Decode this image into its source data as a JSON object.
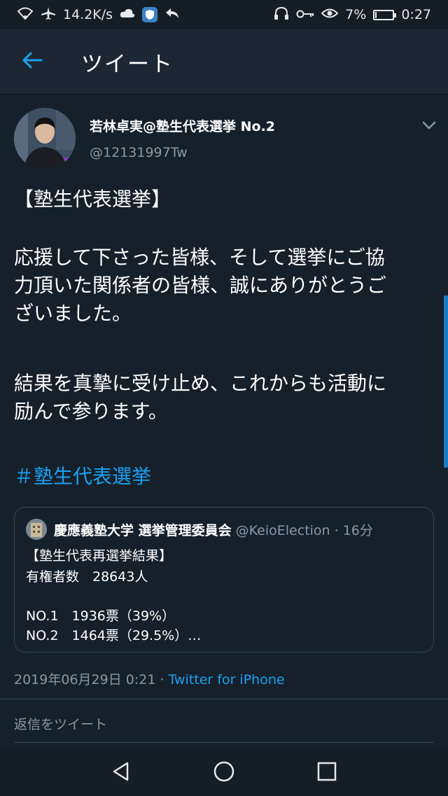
{
  "status_bar": {
    "speed": "14.2K/s",
    "battery": "7%",
    "time": "0:27"
  },
  "header": {
    "title": "ツイート"
  },
  "tweet": {
    "author_name": "若林卓実@塾生代表選挙 No.2",
    "author_handle": "@12131997Tw",
    "text_title": "【塾生代表選挙】",
    "text_p2_l1": "応援して下さった皆様、そして選挙にご協",
    "text_p2_l2": "力頂いた関係者の皆様、誠にありがとうご",
    "text_p2_l3": "ざいました。",
    "text_p3_l1": "結果を真摯に受け止め、これからも活動に",
    "text_p3_l2": "励んで参ります。",
    "hashtag": "＃塾生代表選挙",
    "timestamp": "2019年06月29日 0:21 · ",
    "source": "Twitter for iPhone"
  },
  "quoted": {
    "name": "慶應義塾大学 選挙管理委員会",
    "meta": " @KeioElection · 16分",
    "line1": "【塾生代表再選挙結果】",
    "line2": "有権者数　28643人",
    "line3": "NO.1　1936票（39%）",
    "line4": "NO.2　1464票（29.5%）…"
  },
  "reply": {
    "placeholder": "返信をツイート"
  },
  "colors": {
    "background": "#15202b",
    "accent": "#1da1f2",
    "muted": "#8899a6"
  },
  "icons": [
    "wifi-icon",
    "airplane-icon",
    "cloud-icon",
    "shield-icon",
    "back-arrow-icon",
    "headphones-icon",
    "key-icon",
    "eye-icon",
    "battery-icon",
    "chevron-down-icon",
    "nav-back-icon",
    "nav-home-icon",
    "nav-recents-icon"
  ]
}
